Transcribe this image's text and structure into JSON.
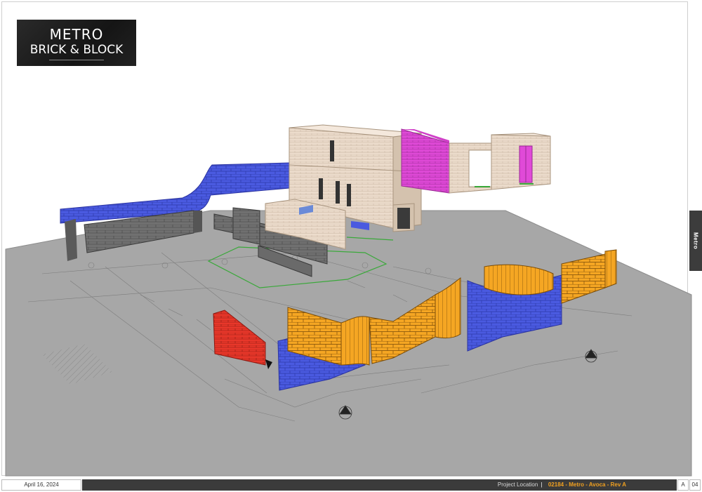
{
  "logo": {
    "line1": "METRO",
    "line2": "BRICK & BLOCK"
  },
  "side_tab": {
    "label": "Metro"
  },
  "footer": {
    "date": "April 16, 2024",
    "location_label": "Project Location",
    "separator": "|",
    "project_code": "02184 - Metro - Avoca - Rev A",
    "revision": "A",
    "page": "04"
  },
  "colors": {
    "blue_wall": "#4a5ae0",
    "orange_wall": "#f5a623",
    "red_wall": "#e8372a",
    "magenta_wall": "#e04ad8",
    "beige_building": "#e8d8c8",
    "grey_block": "#6e6e6e",
    "ground": "#a8a8a8",
    "footer_bar": "#3b3b3b",
    "accent_text": "#f0a020"
  }
}
